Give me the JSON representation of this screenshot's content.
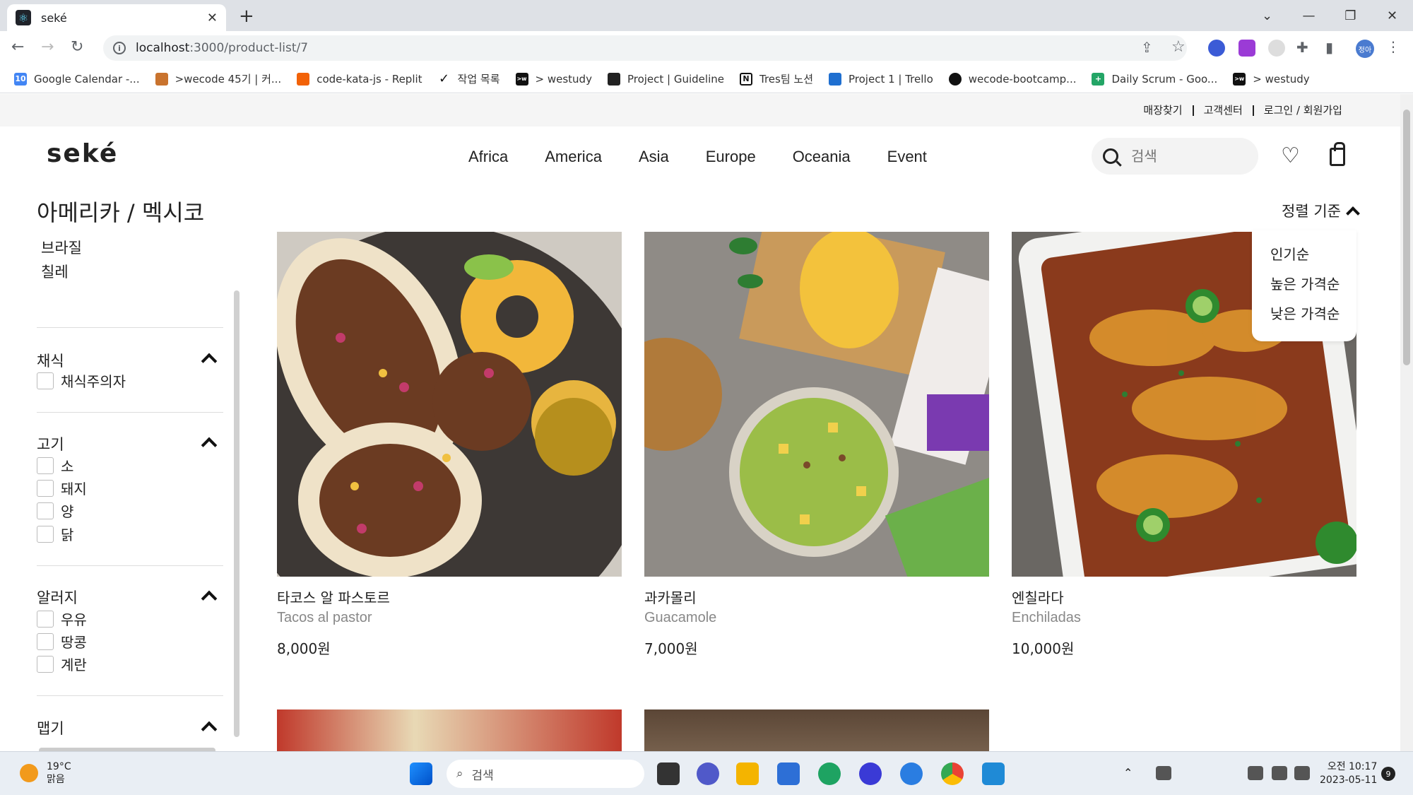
{
  "browser": {
    "tab_title": "seké",
    "url_host": "localhost",
    "url_rest": ":3000/product-list/7",
    "bookmarks": [
      "Google Calendar -...",
      ">wecode 45기 | 커...",
      "code-kata-js - Replit",
      "작업 목록",
      "> westudy",
      "Project | Guideline",
      "Tres팀 노션",
      "Project 1 | Trello",
      "wecode-bootcamp...",
      "Daily Scrum - Goo...",
      "> westudy"
    ],
    "profile_initials": "정아"
  },
  "site": {
    "topbar": [
      "매장찾기",
      "고객센터",
      "로그인 / 회원가입"
    ],
    "logo": "seké",
    "nav": [
      "Africa",
      "America",
      "Asia",
      "Europe",
      "Oceania",
      "Event"
    ],
    "search_placeholder": "검색",
    "page_title": "아메리카 / 멕시코",
    "subcategories": [
      "브라질",
      "칠레"
    ],
    "filters": [
      {
        "title": "채식",
        "options": [
          "채식주의자"
        ]
      },
      {
        "title": "고기",
        "options": [
          "소",
          "돼지",
          "양",
          "닭"
        ]
      },
      {
        "title": "알러지",
        "options": [
          "우유",
          "땅콩",
          "계란"
        ]
      },
      {
        "title": "맵기",
        "options": []
      }
    ],
    "sort": {
      "label": "정렬 기준",
      "options": [
        "인기순",
        "높은 가격순",
        "낮은 가격순"
      ]
    },
    "products": [
      {
        "name_ko": "타코스 알 파스토르",
        "name_en": "Tacos al pastor",
        "price": "8,000원"
      },
      {
        "name_ko": "과카몰리",
        "name_en": "Guacamole",
        "price": "7,000원"
      },
      {
        "name_ko": "엔칠라다",
        "name_en": "Enchiladas",
        "price": "10,000원"
      }
    ]
  },
  "taskbar": {
    "temperature": "19°C",
    "weather": "맑음",
    "search_label": "검색",
    "time": "오전 10:17",
    "date": "2023-05-11",
    "notification_count": "9"
  }
}
